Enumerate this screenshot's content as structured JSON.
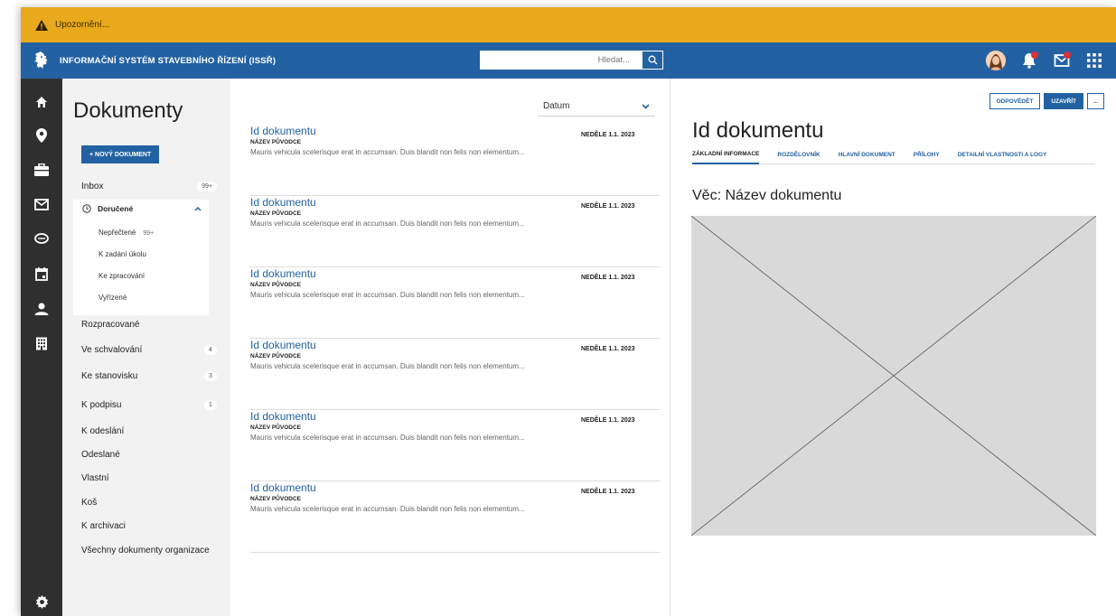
{
  "alert": {
    "text": "Upozornění..."
  },
  "header": {
    "app_title": "INFORMAČNÍ SYSTÉM STAVEBNÍHO ŘÍZENÍ (ISSŘ)",
    "search_placeholder": "Hledat..."
  },
  "nav": {
    "page_title": "Dokumenty",
    "new_button": "+ NOVÝ DOKUMENT",
    "inbox": {
      "label": "Inbox",
      "badge": "99+"
    },
    "received": {
      "label": "Doručené",
      "items": [
        {
          "label": "Nepřečtené",
          "count": "99+"
        },
        {
          "label": "K zadání úkolu"
        },
        {
          "label": "Ke zpracování"
        },
        {
          "label": "Vyřízené"
        }
      ]
    },
    "items": [
      {
        "label": "Rozpracované",
        "badge": ""
      },
      {
        "label": "Ve schvalování",
        "badge": "4"
      },
      {
        "label": "Ke stanovisku",
        "badge": "3"
      },
      {
        "label": "K podpisu",
        "badge": "1"
      },
      {
        "label": "K odeslání",
        "badge": ""
      },
      {
        "label": "Odeslané",
        "badge": ""
      },
      {
        "label": "Vlastní",
        "badge": ""
      },
      {
        "label": "Koš",
        "badge": ""
      },
      {
        "label": "K archivaci",
        "badge": ""
      },
      {
        "label": "Všechny dokumenty organizace",
        "badge": ""
      }
    ]
  },
  "list": {
    "sort_label": "Datum",
    "documents": [
      {
        "title": "Id dokumentu",
        "origin": "NÁZEV PŮVODCE",
        "desc": "Mauris vehicula scelerisque erat in accumsan. Duis blandit non felis non elementum...",
        "date": "NEDĚLE 1.1. 2023"
      },
      {
        "title": "Id dokumentu",
        "origin": "NÁZEV PŮVODCE",
        "desc": "Mauris vehicula scelerisque erat in accumsan. Duis blandit non felis non elementum...",
        "date": "NEDĚLE 1.1. 2023"
      },
      {
        "title": "Id dokumentu",
        "origin": "NÁZEV PŮVODCE",
        "desc": "Mauris vehicula scelerisque erat in accumsan. Duis blandit non felis non elementum...",
        "date": "NEDĚLE 1.1. 2023"
      },
      {
        "title": "Id dokumentu",
        "origin": "NÁZEV PŮVODCE",
        "desc": "Mauris vehicula scelerisque erat in accumsan. Duis blandit non felis non elementum...",
        "date": "NEDĚLE 1.1. 2023"
      },
      {
        "title": "Id dokumentu",
        "origin": "NÁZEV PŮVODCE",
        "desc": "Mauris vehicula scelerisque erat in accumsan. Duis blandit non felis non elementum...",
        "date": "NEDĚLE 1.1. 2023"
      },
      {
        "title": "Id dokumentu",
        "origin": "NÁZEV PŮVODCE",
        "desc": "Mauris vehicula scelerisque erat in accumsan. Duis blandit non felis non elementum...",
        "date": "NEDĚLE 1.1. 2023"
      }
    ]
  },
  "detail": {
    "reply_button": "ODPOVĚDĚT",
    "close_button": "UZAVŘÍT",
    "more_button": "...",
    "title": "Id dokumentu",
    "tabs": [
      "ZÁKLADNÍ INFORMACE",
      "ROZDĚLOVNÍK",
      "HLAVNÍ DOKUMENT",
      "PŘÍLOHY",
      "DETAILNÍ VLASTNOSTI A LOGY"
    ],
    "subject": "Věc: Název dokumentu"
  },
  "colors": {
    "alert": "#e8a91c",
    "brand": "#2362a2",
    "rail": "#2f2f2f",
    "nav_bg": "#f2f2f2",
    "badge_red": "#d9303b"
  },
  "icons": [
    "warning-icon",
    "lion-logo-icon",
    "search-icon",
    "bell-icon",
    "mail-icon",
    "apps-grid-icon",
    "home-icon",
    "location-icon",
    "briefcase-icon",
    "envelope-icon",
    "chat-icon",
    "calendar-icon",
    "user-icon",
    "building-icon",
    "settings-icon",
    "clock-icon",
    "chevron-up-icon",
    "chevron-down-icon"
  ]
}
